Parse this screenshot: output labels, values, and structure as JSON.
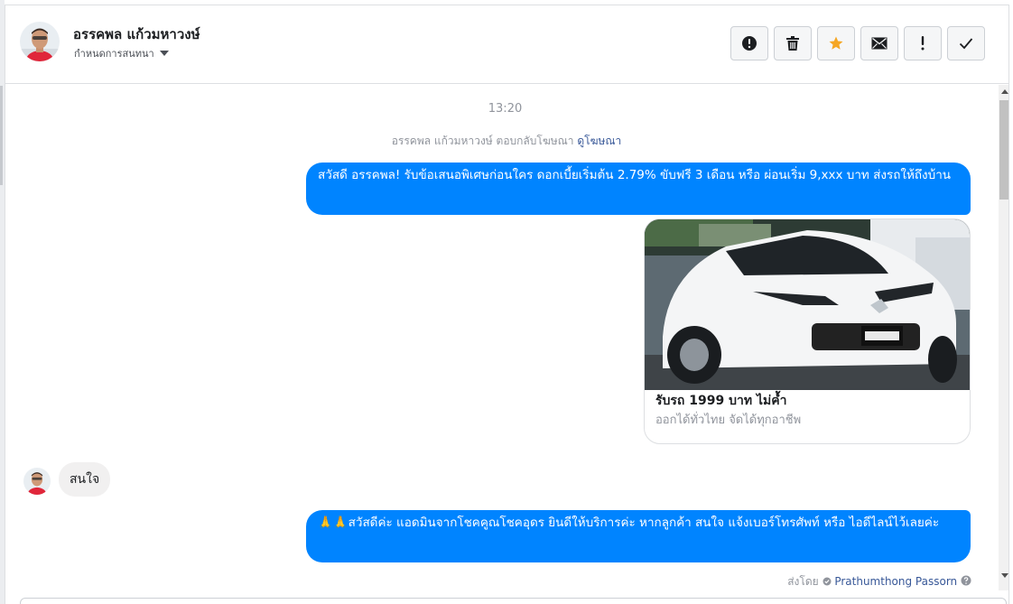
{
  "header": {
    "contact_name": "อรรคพล แก้วมหาวงษ์",
    "assign_label": "กำหนดการสนทนา"
  },
  "toolbar": {
    "buttons": [
      {
        "name": "spam",
        "icon": "alert-circle-icon"
      },
      {
        "name": "delete",
        "icon": "trash-icon"
      },
      {
        "name": "star",
        "icon": "star-icon",
        "color": "#f5a623"
      },
      {
        "name": "mark-unread",
        "icon": "envelope-icon"
      },
      {
        "name": "follow-up",
        "icon": "exclamation-icon"
      },
      {
        "name": "done",
        "icon": "check-icon"
      }
    ]
  },
  "thread": {
    "timestamp": "13:20",
    "ad_reply": {
      "text": "อรรคพล แก้วมหาวงษ์ ตอบกลับโฆษณา",
      "link": "ดูโฆษณา"
    },
    "messages": [
      {
        "direction": "outgoing",
        "text": "สวัสดี อรรคพล! รับข้อเสนอพิเศษก่อนใคร ดอกเบี้ยเริ่มต้น 2.79%  ขับฟรี 3 เดือน หรือ ผ่อนเริ่ม 9,xxx บาท ส่งรถให้ถึงบ้าน"
      },
      {
        "direction": "outgoing",
        "type": "card",
        "title": "รับรถ 1999 บาท ไม่ค้ำ",
        "subtitle": "ออกได้ทั่วไทย จัดได้ทุกอาชีพ"
      },
      {
        "direction": "incoming",
        "text": "สนใจ"
      },
      {
        "direction": "outgoing",
        "emoji": "🙏🙏",
        "text": "สวัสดีค่ะ แอดมินจากโชคคูณโชคอุดร ยินดีให้บริการค่ะ หากลูกค้า สนใจ แจ้งเบอร์โทรศัพท์ หรือ ไอดีไลน์ไว้เลยค่ะ"
      }
    ],
    "sent_by": {
      "label": "ส่งโดย",
      "name": "Prathumthong Passorn"
    }
  },
  "colors": {
    "outgoing_bubble": "#0084ff",
    "incoming_bubble": "#f1f0f0",
    "link": "#385898"
  }
}
